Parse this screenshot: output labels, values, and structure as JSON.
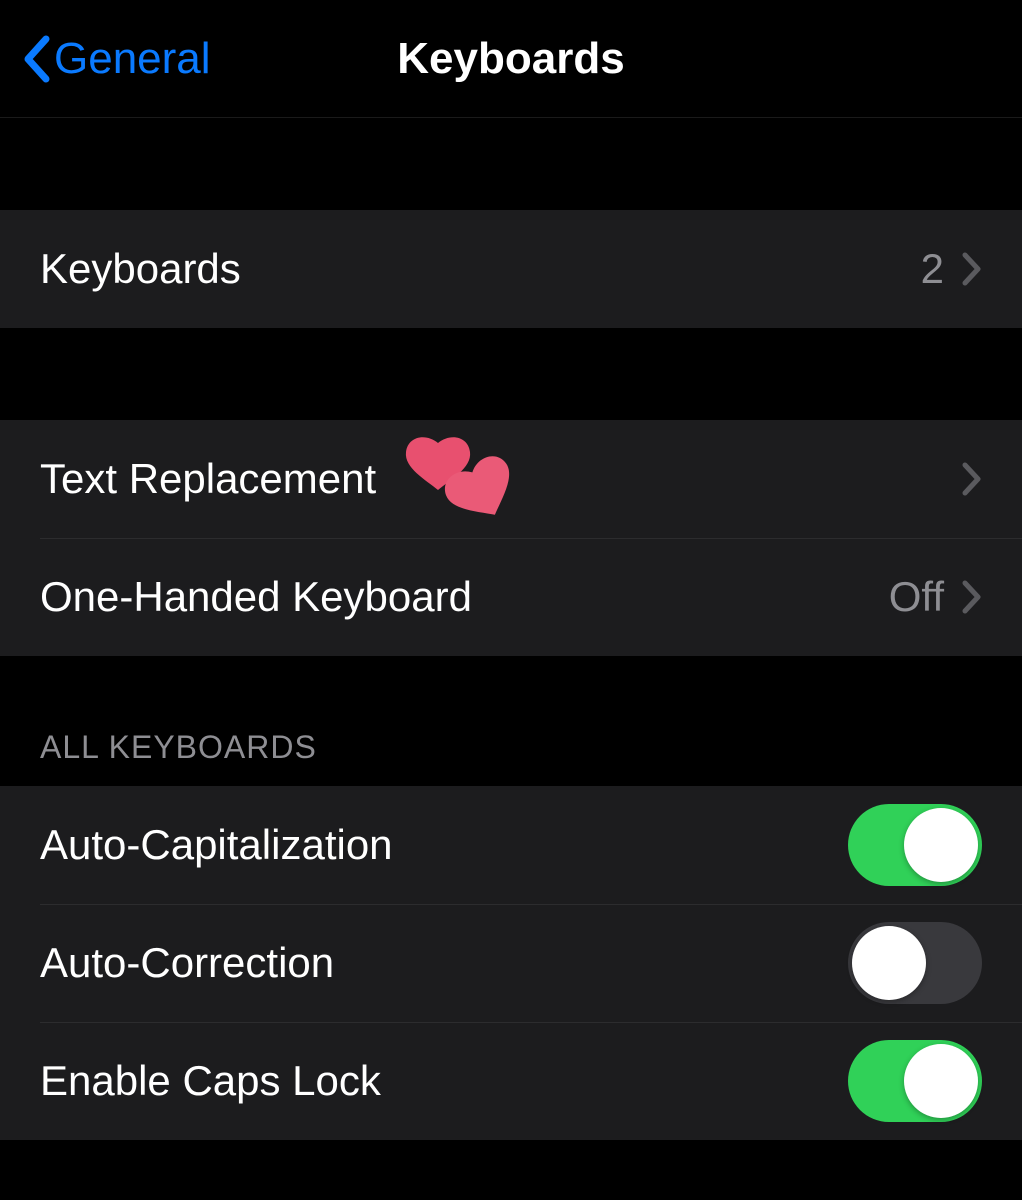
{
  "nav": {
    "back_label": "General",
    "title": "Keyboards"
  },
  "sections": {
    "keyboards_row": {
      "label": "Keyboards",
      "value": "2"
    },
    "text_replacement": {
      "label": "Text Replacement"
    },
    "one_handed": {
      "label": "One-Handed Keyboard",
      "value": "Off"
    },
    "all_keyboards_header": "ALL KEYBOARDS",
    "auto_capitalization": {
      "label": "Auto-Capitalization",
      "enabled": true
    },
    "auto_correction": {
      "label": "Auto-Correction",
      "enabled": false
    },
    "enable_caps_lock": {
      "label": "Enable Caps Lock",
      "enabled": true
    }
  },
  "colors": {
    "accent_blue": "#0a7aff",
    "toggle_green": "#30d158",
    "cell_bg": "#1c1c1e",
    "secondary_text": "#8e8e93"
  },
  "icons": {
    "hearts": "two-hearts-icon"
  }
}
